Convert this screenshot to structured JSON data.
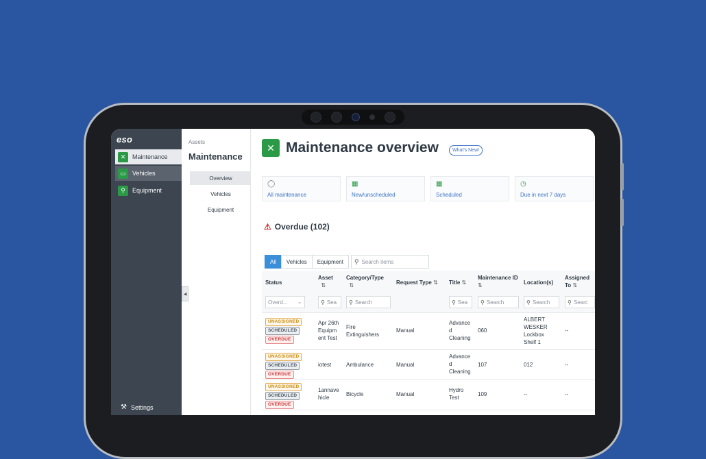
{
  "app": {
    "logo": "eso",
    "nav": [
      {
        "label": "Maintenance",
        "icon": "wrench-screwdriver-icon",
        "active": true
      },
      {
        "label": "Vehicles",
        "icon": "vehicle-icon",
        "active": true
      },
      {
        "label": "Equipment",
        "icon": "equipment-icon",
        "active": false
      }
    ],
    "settings_label": "Settings"
  },
  "subnav": {
    "breadcrumb": "Assets",
    "title": "Maintenance",
    "items": [
      "Overview",
      "Vehicles",
      "Equipment"
    ]
  },
  "header": {
    "title": "Maintenance overview",
    "whats_new": "What's New!"
  },
  "cards": [
    {
      "label": "All maintenance",
      "icon": "check-circle-icon"
    },
    {
      "label": "New/unscheduled",
      "icon": "calendar-plus-icon"
    },
    {
      "label": "Scheduled",
      "icon": "calendar-icon"
    },
    {
      "label": "Due in next 7 days",
      "icon": "clock-icon"
    }
  ],
  "overdue": {
    "title": "Overdue (102)"
  },
  "filters": {
    "tabs": [
      "All",
      "Vehicles",
      "Equipment"
    ],
    "search_placeholder": "Search items"
  },
  "table": {
    "columns": [
      {
        "label": "Status",
        "sortable": false
      },
      {
        "label": "Asset",
        "sortable": true
      },
      {
        "label": "Category/Type",
        "sortable": true
      },
      {
        "label": "Request Type",
        "sortable": true
      },
      {
        "label": "Title",
        "sortable": true
      },
      {
        "label": "Maintenance ID",
        "sortable": true
      },
      {
        "label": "Location(s)",
        "sortable": false
      },
      {
        "label": "Assigned To",
        "sortable": true
      }
    ],
    "status_filter": "Overd...",
    "search_short": "Sea",
    "search_label": "Search",
    "search_cut": "Searc",
    "rows": [
      {
        "badges": [
          "UNASSIGNED",
          "SCHEDULED",
          "OVERDUE"
        ],
        "asset": "Apr 26th Equipm ent Test",
        "category": "Fire Extinguishers",
        "request": "Manual",
        "title": "Advance d Cleaning",
        "id": "060",
        "location": "ALBERT WESKER Lockbox Shelf 1",
        "assigned": "--"
      },
      {
        "badges": [
          "UNASSIGNED",
          "SCHEDULED",
          "OVERDUE"
        ],
        "asset": "iotest",
        "category": "Ambulance",
        "request": "Manual",
        "title": "Advance d Cleaning",
        "id": "107",
        "location": "012",
        "assigned": "--"
      },
      {
        "badges": [
          "UNASSIGNED",
          "SCHEDULED",
          "OVERDUE"
        ],
        "asset": "1annave hicle",
        "category": "Bicycle",
        "request": "Manual",
        "title": "Hydro Test",
        "id": "109",
        "location": "--",
        "assigned": "--"
      }
    ]
  },
  "colors": {
    "background": "#2a56a1",
    "accent_green": "#2a9a47",
    "link_blue": "#3b73c5",
    "nav_bg": "#3c4550"
  }
}
